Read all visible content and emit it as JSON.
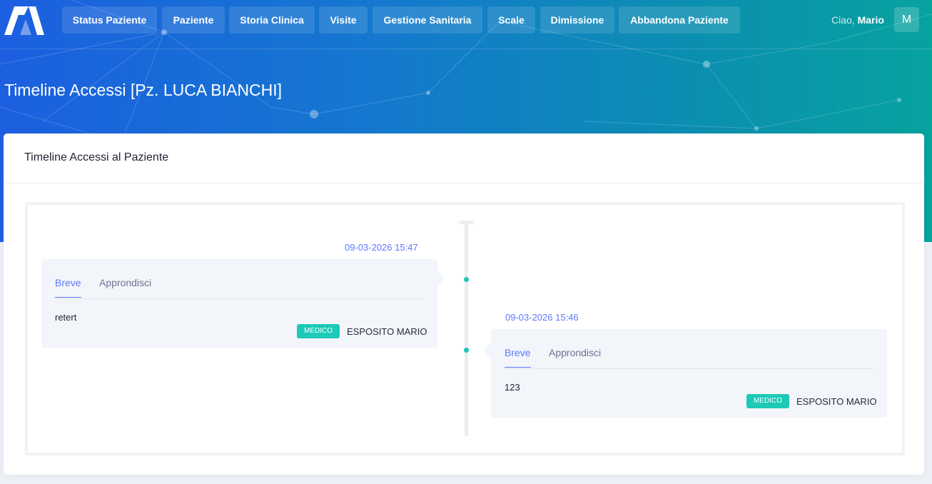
{
  "nav": {
    "items": [
      {
        "label": "Status Paziente"
      },
      {
        "label": "Paziente"
      },
      {
        "label": "Storia Clinica"
      },
      {
        "label": "Visite"
      },
      {
        "label": "Gestione Sanitaria"
      },
      {
        "label": "Scale"
      },
      {
        "label": "Dimissione"
      },
      {
        "label": "Abbandona Paziente"
      }
    ]
  },
  "user": {
    "greeting": "Ciao,",
    "name": "Mario",
    "avatar_initial": "M"
  },
  "page": {
    "title": "Timeline Accessi [Pz. LUCA BIANCHI]"
  },
  "card": {
    "title": "Timeline Accessi al Paziente"
  },
  "timeline": {
    "entries": [
      {
        "date": "09-03-2026 15:47",
        "tabs": {
          "short": "Breve",
          "more": "Approndisci"
        },
        "content": "retert",
        "role": "MEDICO",
        "author": "ESPOSITO MARIO"
      },
      {
        "date": "09-03-2026 15:46",
        "tabs": {
          "short": "Breve",
          "more": "Approndisci"
        },
        "content": "123",
        "role": "MEDICO",
        "author": "ESPOSITO MARIO"
      }
    ]
  },
  "colors": {
    "accent": "#5d78ff",
    "badge": "#1dc9b7",
    "dot": "#1fc5ba"
  }
}
